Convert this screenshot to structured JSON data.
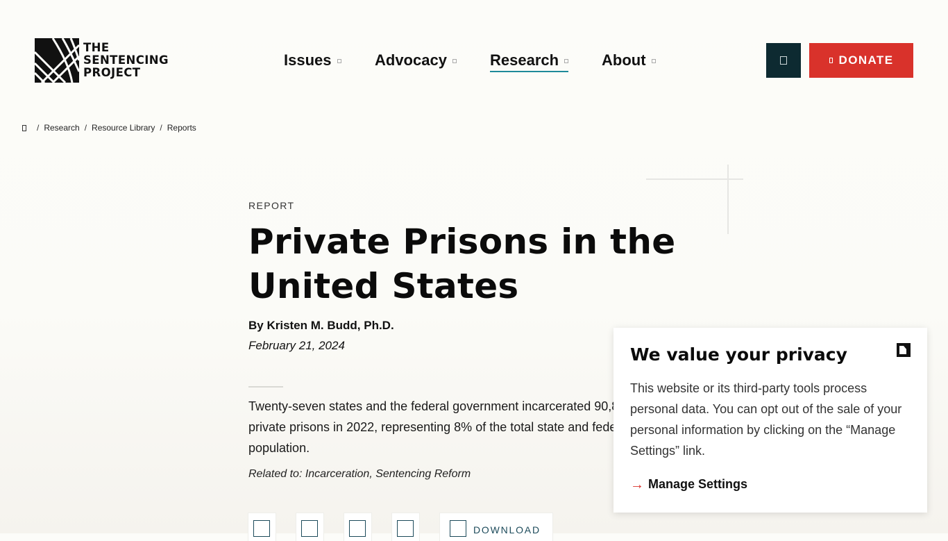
{
  "brand": {
    "logo_lines": [
      "THE",
      "SENTENCING",
      "PROJECT"
    ],
    "logo_icon": "sentencing-project-logo"
  },
  "nav": {
    "items": [
      {
        "label": "Issues",
        "active": false
      },
      {
        "label": "Advocacy",
        "active": false
      },
      {
        "label": "Research",
        "active": true
      },
      {
        "label": "About",
        "active": false
      }
    ]
  },
  "header_actions": {
    "search_icon": "search-icon",
    "donate_label": "DONATE"
  },
  "breadcrumb": {
    "home_icon": "home-icon",
    "items": [
      "Research",
      "Resource Library",
      "Reports"
    ]
  },
  "article": {
    "kicker": "REPORT",
    "title": "Private Prisons in the United States",
    "author": "By Kristen M. Budd, Ph.D.",
    "date": "February 21, 2024",
    "summary": "Twenty-seven states and the federal government incarcerated 90,8",
    "summary_line2": "private prisons in 2022, representing 8% of the total state and fede",
    "summary_line3": "population.",
    "related": "Related to: Incarceration, Sentencing Reform"
  },
  "actions": {
    "download_label": "DOWNLOAD"
  },
  "privacy": {
    "title": "We value your privacy",
    "body": "This website or its third-party tools process personal data. You can opt out of the sale of your personal information by clicking on the “Manage Settings” link.",
    "manage_label": "Manage Settings",
    "arrow": "→"
  },
  "colors": {
    "accent_red": "#d9322b",
    "dark_teal": "#0d2a31",
    "nav_underline": "#1e8a9a"
  }
}
